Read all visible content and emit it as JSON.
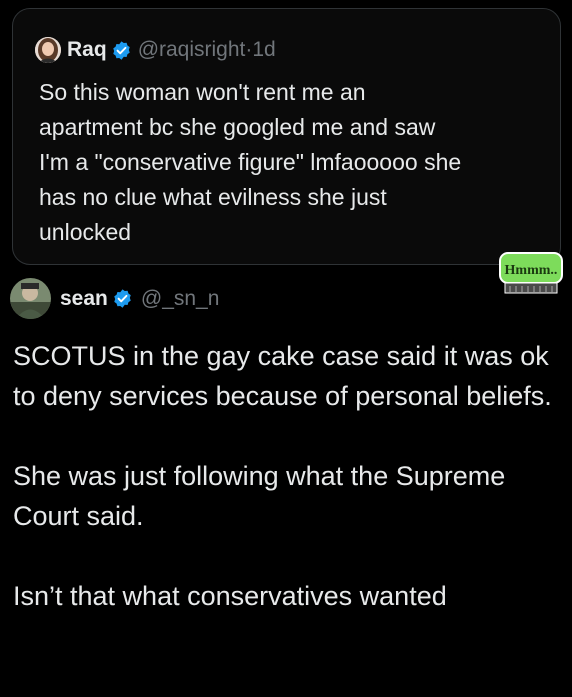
{
  "quoted_tweet": {
    "name": "Raq",
    "handle": "@raqisright",
    "separator": "·",
    "time": "1d",
    "text": "So this woman won't rent me an\napartment bc she googled me and saw\nI'm a \"conservative figure\" lmfaooooo she\nhas no clue what evilness she just\nunlocked"
  },
  "main_tweet": {
    "name": "sean",
    "handle": "@_sn_n",
    "paragraphs": [
      "SCOTUS in the gay cake case said it was ok to deny services because of personal beliefs.",
      "She was just following what the Supreme Court said.",
      "Isn’t that what conservatives wanted"
    ]
  },
  "watermark": {
    "text": "Hmmm.."
  },
  "colors": {
    "background": "#000000",
    "text": "#e7e9ea",
    "muted": "#71767b",
    "verified": "#1d9bf0",
    "sticker": "#7ddc5b"
  },
  "icons": [
    "verified-badge-icon",
    "avatar-raq",
    "avatar-sean"
  ]
}
